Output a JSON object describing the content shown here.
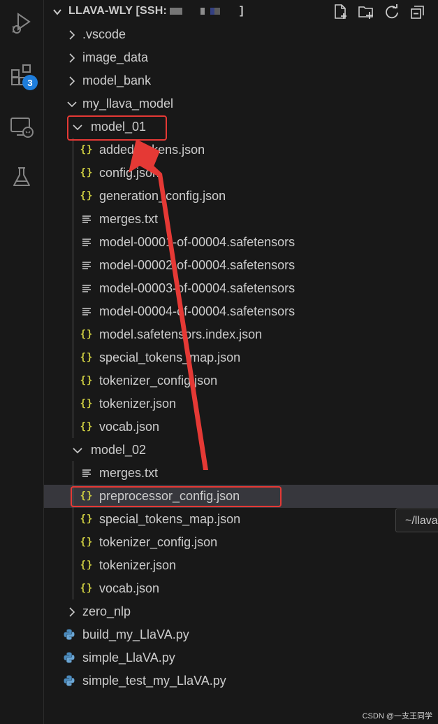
{
  "activity_bar": {
    "extensions_badge": "3",
    "icons": [
      "run-debug-icon",
      "extensions-icon",
      "remote-explorer-icon",
      "testing-icon"
    ]
  },
  "explorer": {
    "title": "LLAVA-WLY [SSH:",
    "title_end": "]",
    "actions": [
      "new-file-icon",
      "new-folder-icon",
      "refresh-icon",
      "collapse-all-icon"
    ],
    "tree": [
      {
        "label": ".vscode",
        "type": "folder",
        "expanded": false,
        "depth": 0
      },
      {
        "label": "image_data",
        "type": "folder",
        "expanded": false,
        "depth": 0
      },
      {
        "label": "model_bank",
        "type": "folder",
        "expanded": false,
        "depth": 0
      },
      {
        "label": "my_llava_model",
        "type": "folder",
        "expanded": true,
        "depth": 0
      },
      {
        "label": "model_01",
        "type": "folder",
        "expanded": true,
        "depth": 1
      },
      {
        "label": "added_tokens.json",
        "type": "json",
        "depth": 2
      },
      {
        "label": "config.json",
        "type": "json",
        "depth": 2
      },
      {
        "label": "generation_config.json",
        "type": "json",
        "depth": 2
      },
      {
        "label": "merges.txt",
        "type": "text",
        "depth": 2
      },
      {
        "label": "model-00001-of-00004.safetensors",
        "type": "text",
        "depth": 2
      },
      {
        "label": "model-00002-of-00004.safetensors",
        "type": "text",
        "depth": 2
      },
      {
        "label": "model-00003-of-00004.safetensors",
        "type": "text",
        "depth": 2
      },
      {
        "label": "model-00004-of-00004.safetensors",
        "type": "text",
        "depth": 2
      },
      {
        "label": "model.safetensors.index.json",
        "type": "json",
        "depth": 2
      },
      {
        "label": "special_tokens_map.json",
        "type": "json",
        "depth": 2
      },
      {
        "label": "tokenizer_config.json",
        "type": "json",
        "depth": 2
      },
      {
        "label": "tokenizer.json",
        "type": "json",
        "depth": 2
      },
      {
        "label": "vocab.json",
        "type": "json",
        "depth": 2
      },
      {
        "label": "model_02",
        "type": "folder",
        "expanded": true,
        "depth": 1
      },
      {
        "label": "merges.txt",
        "type": "text",
        "depth": 2
      },
      {
        "label": "preprocessor_config.json",
        "type": "json",
        "depth": 2,
        "selected": true
      },
      {
        "label": "special_tokens_map.json",
        "type": "json",
        "depth": 2
      },
      {
        "label": "tokenizer_config.json",
        "type": "json",
        "depth": 2
      },
      {
        "label": "tokenizer.json",
        "type": "json",
        "depth": 2
      },
      {
        "label": "vocab.json",
        "type": "json",
        "depth": 2
      },
      {
        "label": "zero_nlp",
        "type": "folder",
        "expanded": false,
        "depth": 0
      },
      {
        "label": "build_my_LlaVA.py",
        "type": "python",
        "depth": -1
      },
      {
        "label": "simple_LlaVA.py",
        "type": "python",
        "depth": -1
      },
      {
        "label": "simple_test_my_LlaVA.py",
        "type": "python",
        "depth": -1
      }
    ]
  },
  "tooltip": "~/llava",
  "watermark": "CSDN @一支王同学",
  "colors": {
    "background": "#181818",
    "text": "#cccccc",
    "selection": "#37373d",
    "json_icon": "#cbcb41",
    "python_icon": "#4b8bbe",
    "annotation_red": "#e53935",
    "badge": "#1e7ddb"
  }
}
